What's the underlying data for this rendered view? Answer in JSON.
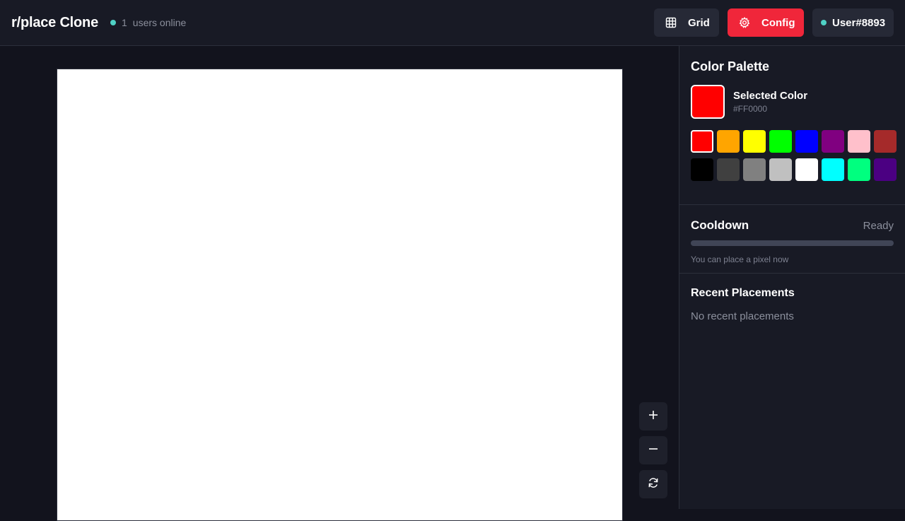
{
  "header": {
    "title": "r/place Clone",
    "online_count": "1",
    "online_label": "users online",
    "grid_label": "Grid",
    "config_label": "Config",
    "user_label": "User#8893"
  },
  "zoom": {
    "in_icon": "plus-icon",
    "out_icon": "minus-icon",
    "reset_icon": "refresh-icon"
  },
  "palette": {
    "title": "Color Palette",
    "selected_label": "Selected Color",
    "selected_hex": "#FF0000",
    "selected_color": "#FF0000",
    "colors": [
      "#FF0000",
      "#FFA500",
      "#FFFF00",
      "#00FF00",
      "#0000FF",
      "#800080",
      "#FFC0CB",
      "#A52A2A",
      "#000000",
      "#404040",
      "#808080",
      "#C0C0C0",
      "#FFFFFF",
      "#00FFFF",
      "#00FF7F",
      "#4B0082"
    ]
  },
  "cooldown": {
    "title": "Cooldown",
    "status": "Ready",
    "progress": 0,
    "hint": "You can place a pixel now"
  },
  "recent": {
    "title": "Recent Placements",
    "empty_text": "No recent placements"
  },
  "colors": {
    "accent": "#f0263a",
    "online_dot": "#4fd1c5",
    "background": "#12131d",
    "panel": "#181a25"
  }
}
